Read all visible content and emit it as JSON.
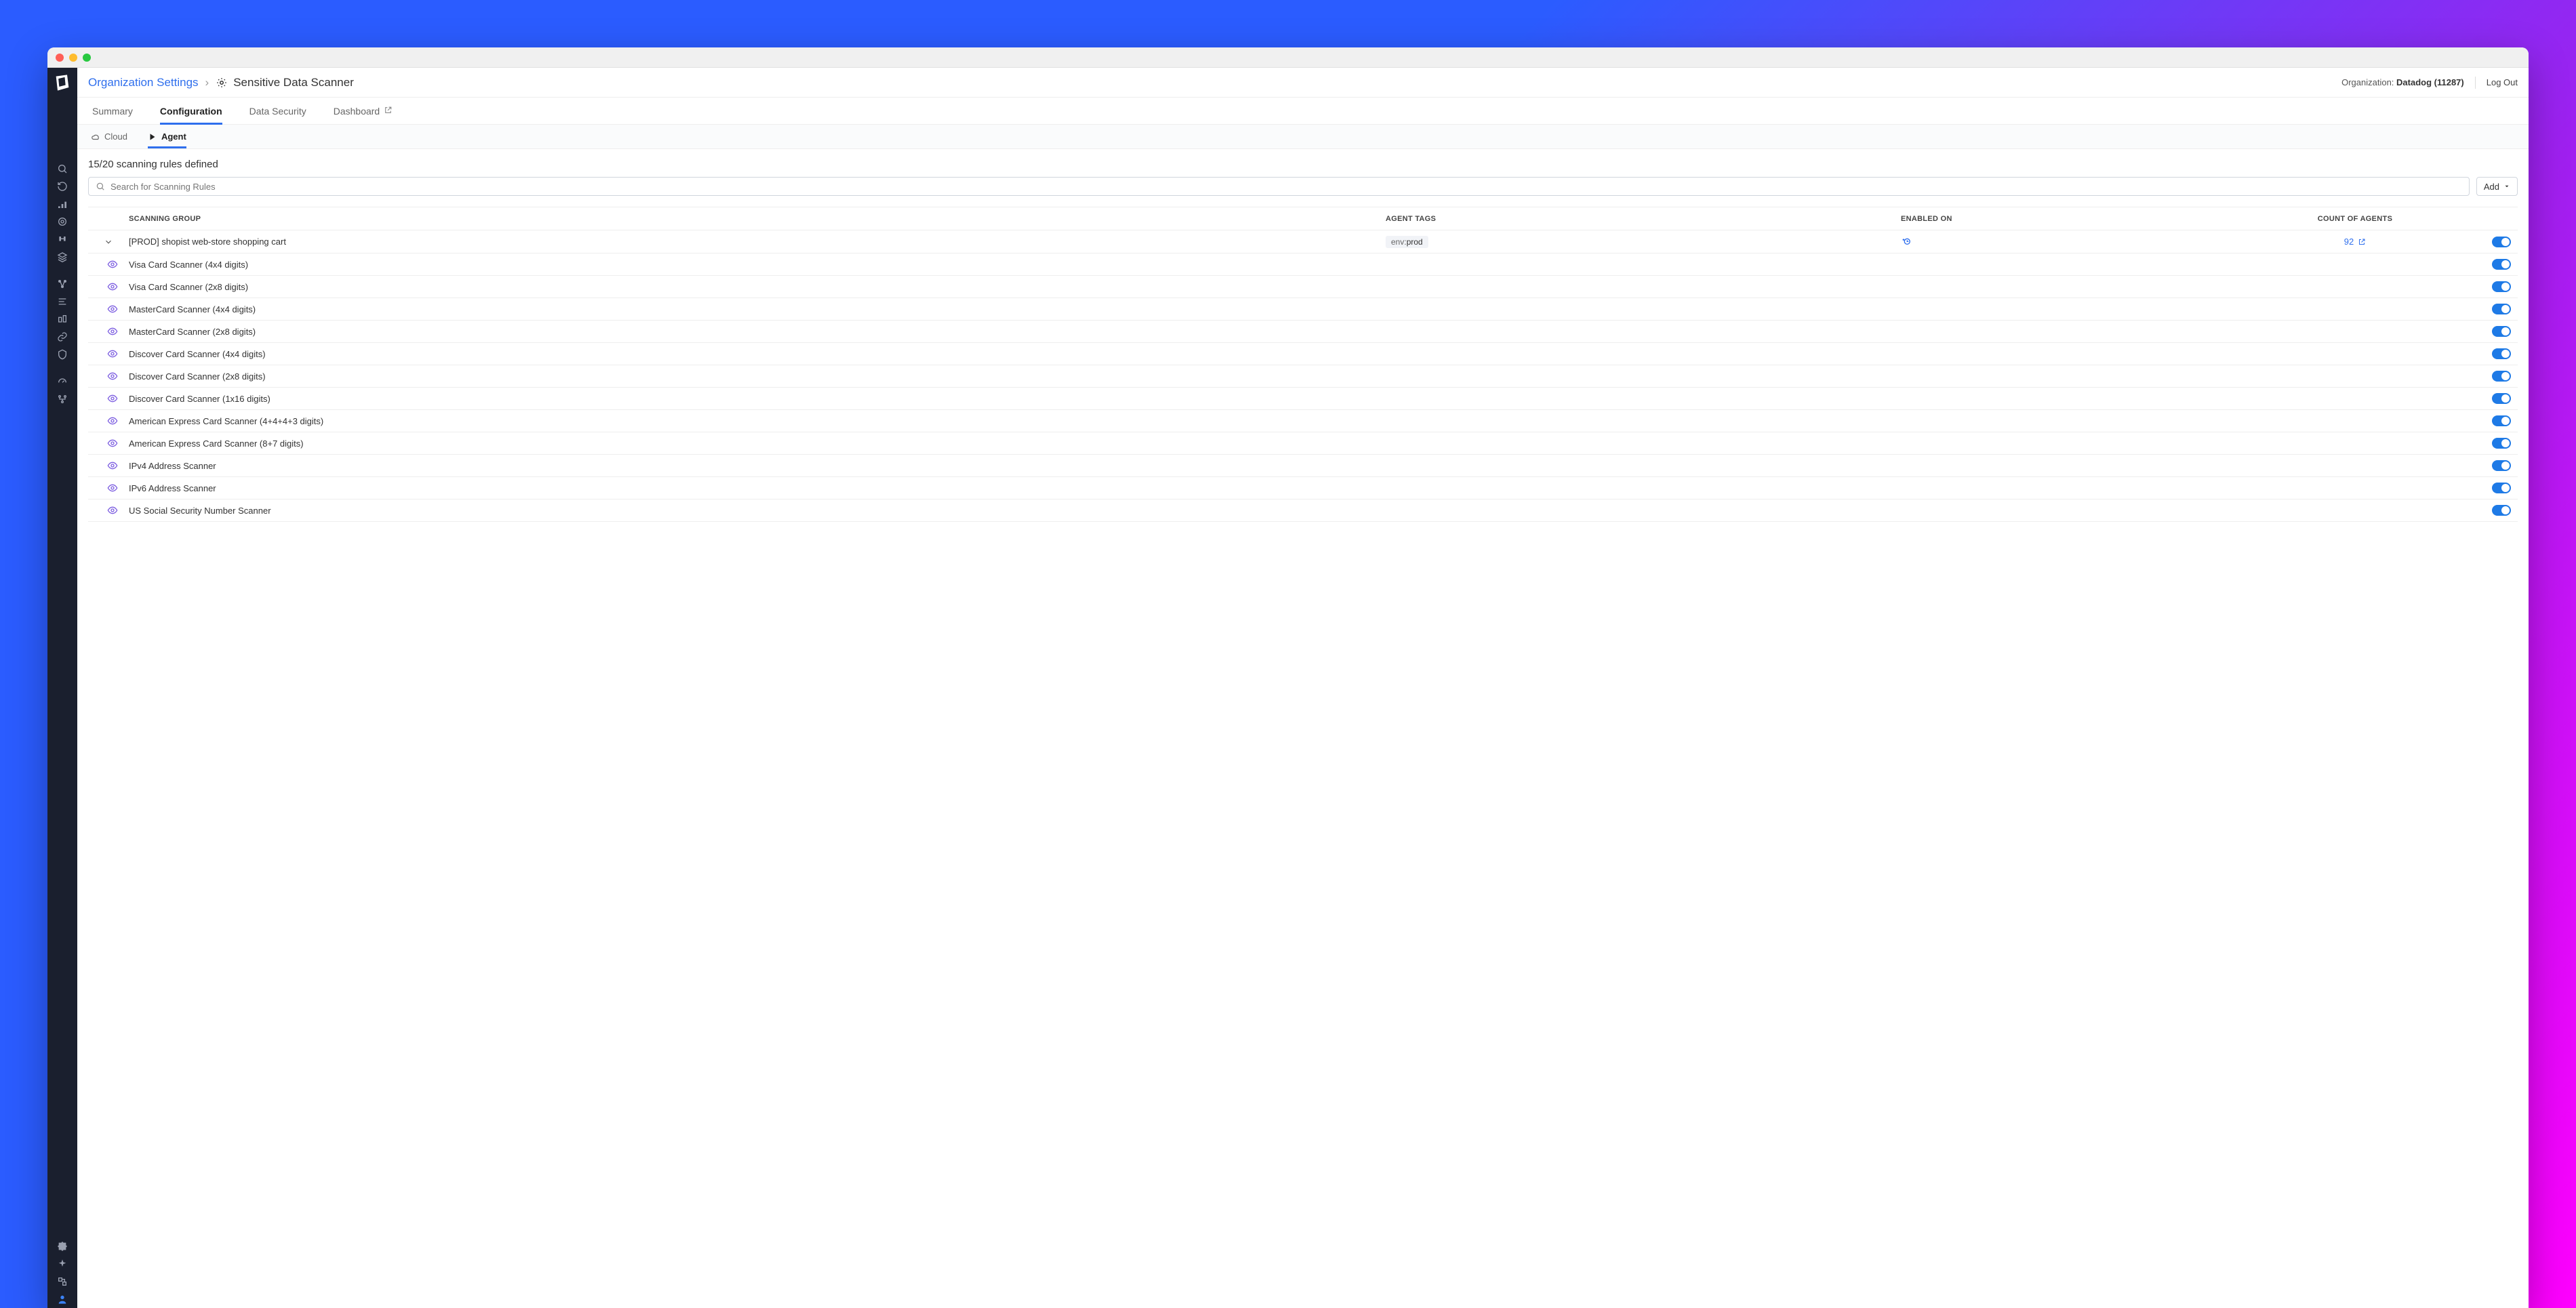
{
  "breadcrumb": {
    "root": "Organization Settings",
    "title": "Sensitive Data Scanner"
  },
  "header": {
    "org_label": "Organization: ",
    "org_value": "Datadog (11287)",
    "logout": "Log Out"
  },
  "tabs": [
    {
      "label": "Summary",
      "active": false
    },
    {
      "label": "Configuration",
      "active": true
    },
    {
      "label": "Data Security",
      "active": false
    },
    {
      "label": "Dashboard",
      "active": false,
      "external": true
    }
  ],
  "subtabs": [
    {
      "label": "Cloud",
      "icon": "cloud",
      "active": false
    },
    {
      "label": "Agent",
      "icon": "agent",
      "active": true
    }
  ],
  "status": "15/20 scanning rules defined",
  "search": {
    "placeholder": "Search for Scanning Rules"
  },
  "add_button": "Add",
  "columns": {
    "group": "SCANNING GROUP",
    "tags": "AGENT TAGS",
    "enabled": "ENABLED ON",
    "count": "COUNT OF AGENTS"
  },
  "group": {
    "name": "[PROD] shopist web-store shopping cart",
    "tag_key": "env:",
    "tag_value": "prod",
    "agent_count": "92",
    "enabled": true
  },
  "rules": [
    {
      "name": "Visa Card Scanner (4x4 digits)",
      "enabled": true
    },
    {
      "name": "Visa Card Scanner (2x8 digits)",
      "enabled": true
    },
    {
      "name": "MasterCard Scanner (4x4 digits)",
      "enabled": true
    },
    {
      "name": "MasterCard Scanner (2x8 digits)",
      "enabled": true
    },
    {
      "name": "Discover Card Scanner (4x4 digits)",
      "enabled": true
    },
    {
      "name": "Discover Card Scanner (2x8 digits)",
      "enabled": true
    },
    {
      "name": "Discover Card Scanner (1x16 digits)",
      "enabled": true
    },
    {
      "name": "American Express Card Scanner (4+4+4+3 digits)",
      "enabled": true
    },
    {
      "name": "American Express Card Scanner (8+7 digits)",
      "enabled": true
    },
    {
      "name": "IPv4 Address Scanner",
      "enabled": true
    },
    {
      "name": "IPv6 Address Scanner",
      "enabled": true
    },
    {
      "name": "US Social Security Number Scanner",
      "enabled": true
    }
  ]
}
